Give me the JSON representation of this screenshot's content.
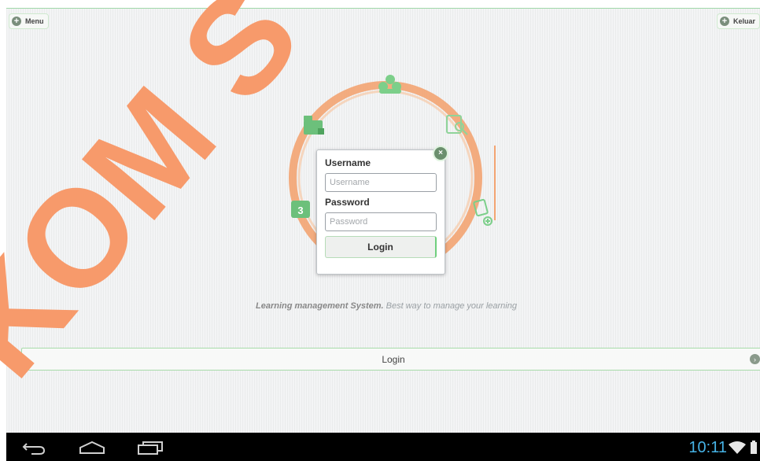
{
  "header": {
    "menu_label": "Menu",
    "keluar_label": "Keluar",
    "plus_glyph": "+"
  },
  "login_dialog": {
    "username_label": "Username",
    "username_placeholder": "Username",
    "password_label": "Password",
    "password_placeholder": "Password",
    "login_button": "Login",
    "close_glyph": "×"
  },
  "tagline": {
    "bold": "Learning management System.",
    "rest": " Best way to manage your learning"
  },
  "login_bar": {
    "label": "Login",
    "arrow_glyph": "›"
  },
  "watermark": {
    "text": "KOM S",
    "color": "#f79a6b"
  },
  "status_bar": {
    "time": "10:11"
  },
  "colors": {
    "accent_green": "#6fcf7d",
    "ring_orange": "#f3a472",
    "clock_blue": "#46b3e6"
  },
  "icons": [
    "menu-plus-icon",
    "keluar-plus-icon",
    "close-icon",
    "users-icon",
    "folder-icon",
    "search-icon",
    "book-icon",
    "add-note-icon",
    "back-icon",
    "home-icon",
    "recent-apps-icon",
    "wifi-icon",
    "battery-icon"
  ]
}
